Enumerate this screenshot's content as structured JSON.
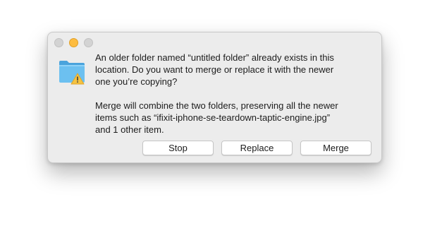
{
  "window_controls": {
    "close": {
      "color": "#d3d3d3"
    },
    "minimize": {
      "color": "#fdbc40"
    },
    "zoom": {
      "color": "#d3d3d3"
    }
  },
  "icon": {
    "name": "folder-warning-icon",
    "folder_color": "#5ab4ea",
    "badge_color": "#f5c342"
  },
  "message": {
    "main": "An older folder named “untitled folder” already exists in this\nlocation. Do you want to merge or replace it with the newer\none you’re copying?",
    "detail": "Merge will combine the two folders, preserving all the newer\nitems such as “ifixit-iphone-se-teardown-taptic-engine.jpg”\nand 1 other item."
  },
  "buttons": {
    "stop_label": "Stop",
    "replace_label": "Replace",
    "merge_label": "Merge"
  }
}
